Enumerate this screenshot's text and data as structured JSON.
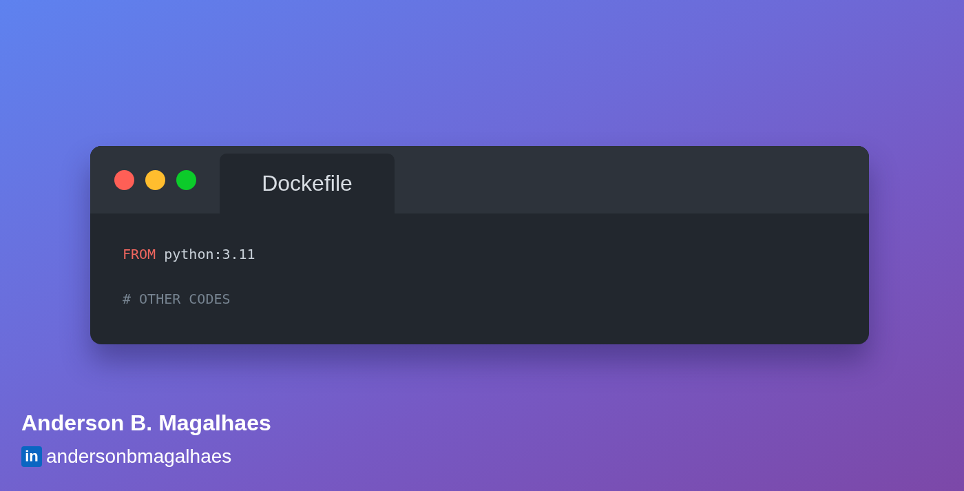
{
  "window": {
    "controls": [
      {
        "color": "#ff5f56"
      },
      {
        "color": "#ffbd2e"
      },
      {
        "color": "#0ccb2a"
      }
    ],
    "tabs": [
      {
        "label": "Dockefile",
        "selected": true
      }
    ]
  },
  "code": {
    "lines": [
      [
        {
          "kind": "keyword",
          "text": "FROM"
        },
        {
          "kind": "plain",
          "text": " python:3.11"
        }
      ],
      [
        {
          "kind": "comment",
          "text": "# OTHER CODES"
        }
      ]
    ]
  },
  "author": {
    "name": "Anderson B. Magalhaes",
    "badge": "in",
    "handle": "andersonbmagalhaes"
  }
}
